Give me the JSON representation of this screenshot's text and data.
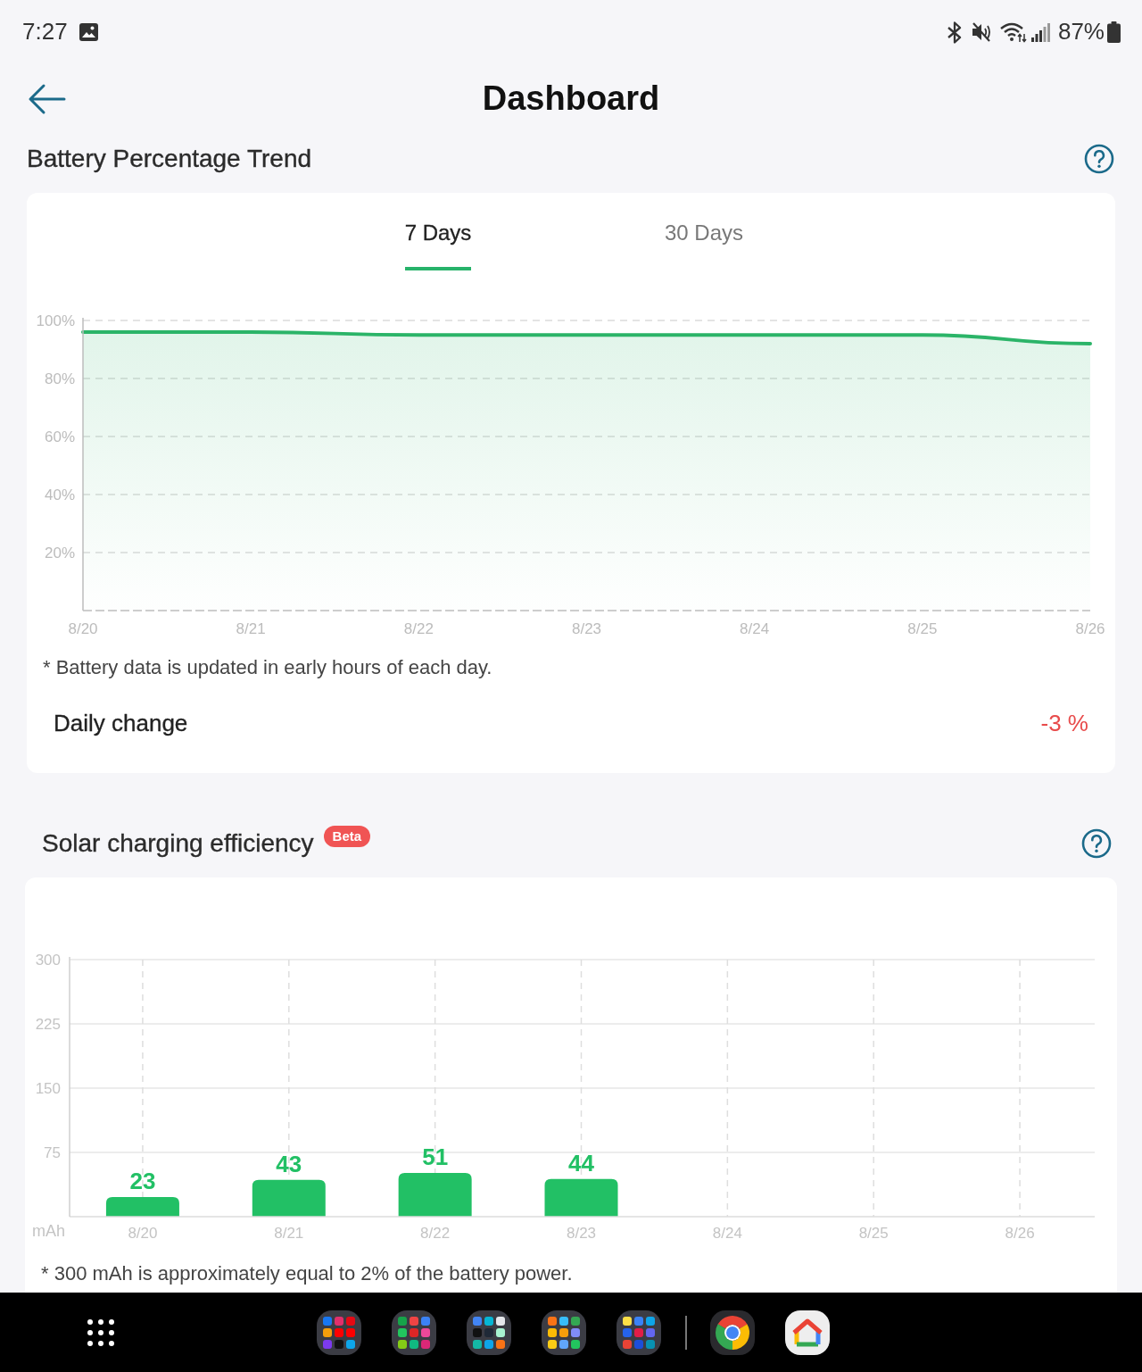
{
  "status_bar": {
    "time": "7:27",
    "battery": "87%"
  },
  "header": {
    "title": "Dashboard"
  },
  "battery_trend": {
    "title": "Battery Percentage Trend",
    "tabs": [
      {
        "label": "7 Days",
        "selected": true
      },
      {
        "label": "30 Days",
        "selected": false
      }
    ],
    "chart_data": {
      "type": "line",
      "categories": [
        "8/20",
        "8/21",
        "8/22",
        "8/23",
        "8/24",
        "8/25",
        "8/26"
      ],
      "series": [
        {
          "color": "#2bb468",
          "values": [
            96,
            96,
            95,
            95,
            95,
            95,
            92
          ]
        }
      ],
      "ylim": [
        0,
        100
      ],
      "yticks": [
        {
          "value": 20,
          "label": "20%"
        },
        {
          "value": 40,
          "label": "40%"
        },
        {
          "value": 60,
          "label": "60%"
        },
        {
          "value": 80,
          "label": "80%"
        },
        {
          "value": 100,
          "label": "100%"
        }
      ],
      "grid": true
    },
    "note": "* Battery data is updated in early hours of each day.",
    "daily_change": {
      "label": "Daily change",
      "value": "-3 %"
    }
  },
  "solar_efficiency": {
    "title": "Solar charging efficiency",
    "badge": "Beta",
    "chart_data": {
      "type": "bar",
      "categories": [
        "8/20",
        "8/21",
        "8/22",
        "8/23",
        "8/24",
        "8/25",
        "8/26"
      ],
      "series": [
        {
          "color": "#22c065",
          "values": [
            23,
            43,
            51,
            44,
            null,
            null,
            null
          ]
        }
      ],
      "ylabel": "mAh",
      "ylim": [
        0,
        300
      ],
      "yticks": [
        75,
        150,
        225,
        300
      ],
      "data_labels": true,
      "grid": true
    },
    "note": "* 300 mAh is approximately equal to 2% of the battery power."
  }
}
